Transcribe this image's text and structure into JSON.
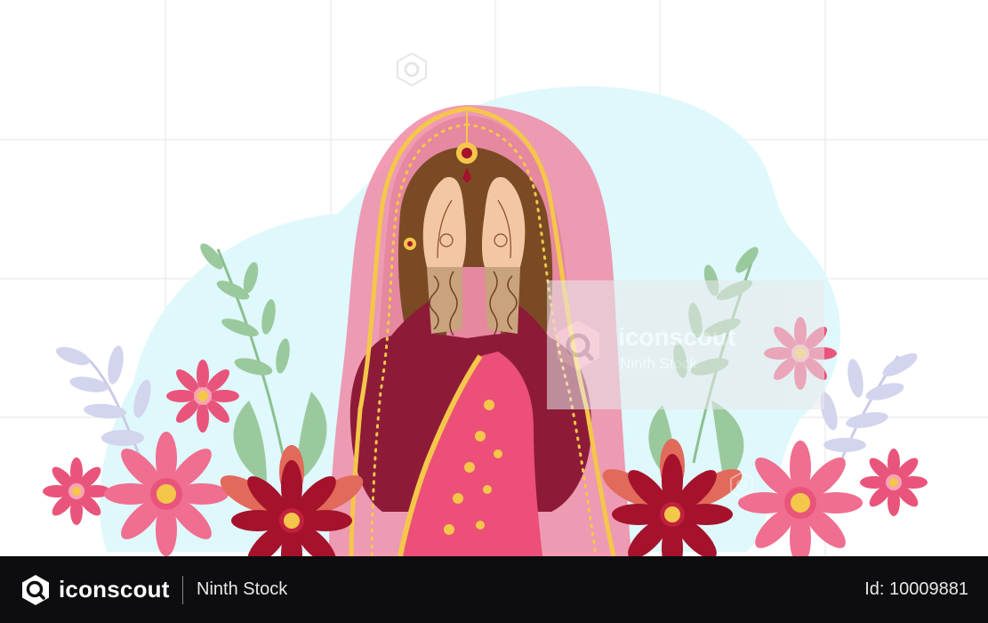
{
  "watermark": {
    "brand": "iconscout",
    "contributor": "Ninth Stock"
  },
  "footer": {
    "brand": "iconscout",
    "contributor": "Ninth Stock",
    "asset_id": "Id: 10009881"
  },
  "colors": {
    "sky_blob": "#dff8fb",
    "veil_pink": "#f08aa6",
    "gold_trim": "#f4c74a",
    "blouse_maroon": "#8d1b38",
    "saree_pink": "#ec4f78",
    "hair_brown": "#7a4a24",
    "skin": "#f3c7a3",
    "leaf_green": "#9bc99e",
    "leaf_lavender": "#d5d6ef",
    "flower_pink": "#e9557a",
    "flower_dark": "#a5122c",
    "footer_bg": "#0d0d0f"
  },
  "icons": [
    "iconscout-logo-icon",
    "watermark-search-icon"
  ]
}
